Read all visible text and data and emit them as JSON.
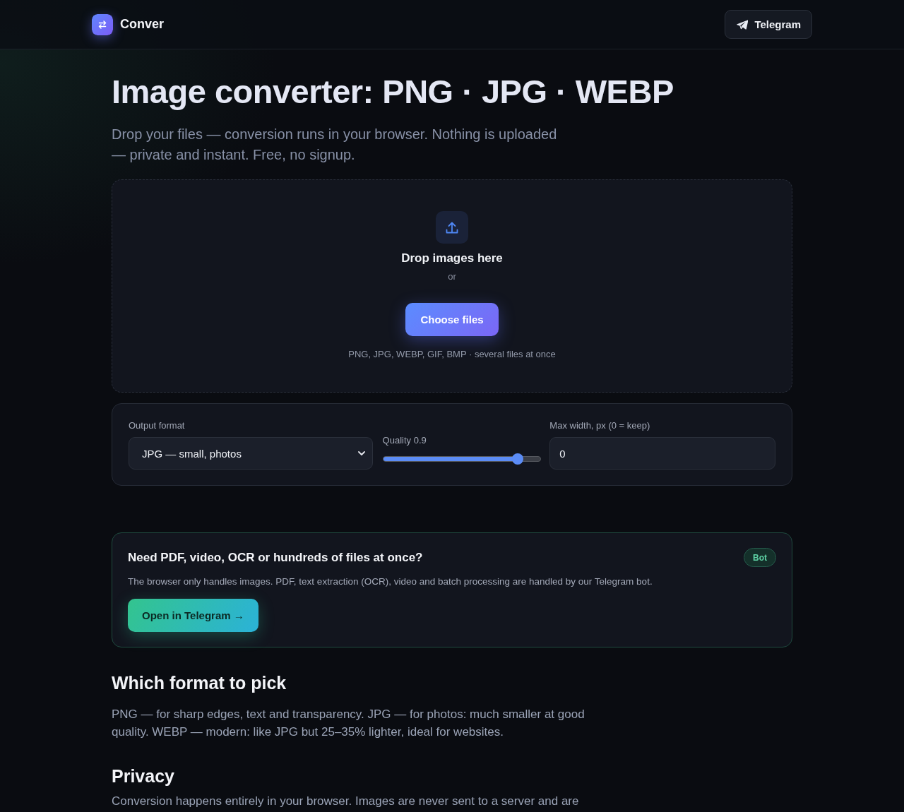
{
  "header": {
    "brand": "Conver",
    "telegram_button": "Telegram"
  },
  "hero": {
    "title": "Image converter: PNG · JPG · WEBP",
    "subtitle": "Drop your files — conversion runs in your browser. Nothing is uploaded — private and instant. Free, no signup."
  },
  "dropzone": {
    "title": "Drop images here",
    "separator": "or",
    "button": "Choose files",
    "hint": "PNG, JPG, WEBP, GIF, BMP · several files at once"
  },
  "settings": {
    "format": {
      "label": "Output format",
      "value": "JPG — small, photos"
    },
    "quality": {
      "label": "Quality 0.9",
      "level": 0.85
    },
    "max_width": {
      "label": "Max width, px (0 = keep)",
      "value": "0"
    }
  },
  "promo": {
    "title": "Need PDF, video, OCR or hundreds of files at once?",
    "badge": "Bot",
    "text": "The browser only handles images. PDF, text extraction (OCR), video and batch processing are handled by our Telegram bot.",
    "button": "Open in Telegram →"
  },
  "sections": [
    {
      "heading": "Which format to pick",
      "text": "PNG — for sharp edges, text and transparency. JPG — for photos: much smaller at good quality. WEBP — modern: like JPG but 25–35% lighter, ideal for websites."
    },
    {
      "heading": "Privacy",
      "text": "Conversion happens entirely in your browser. Images are never sent to a server and are"
    }
  ]
}
